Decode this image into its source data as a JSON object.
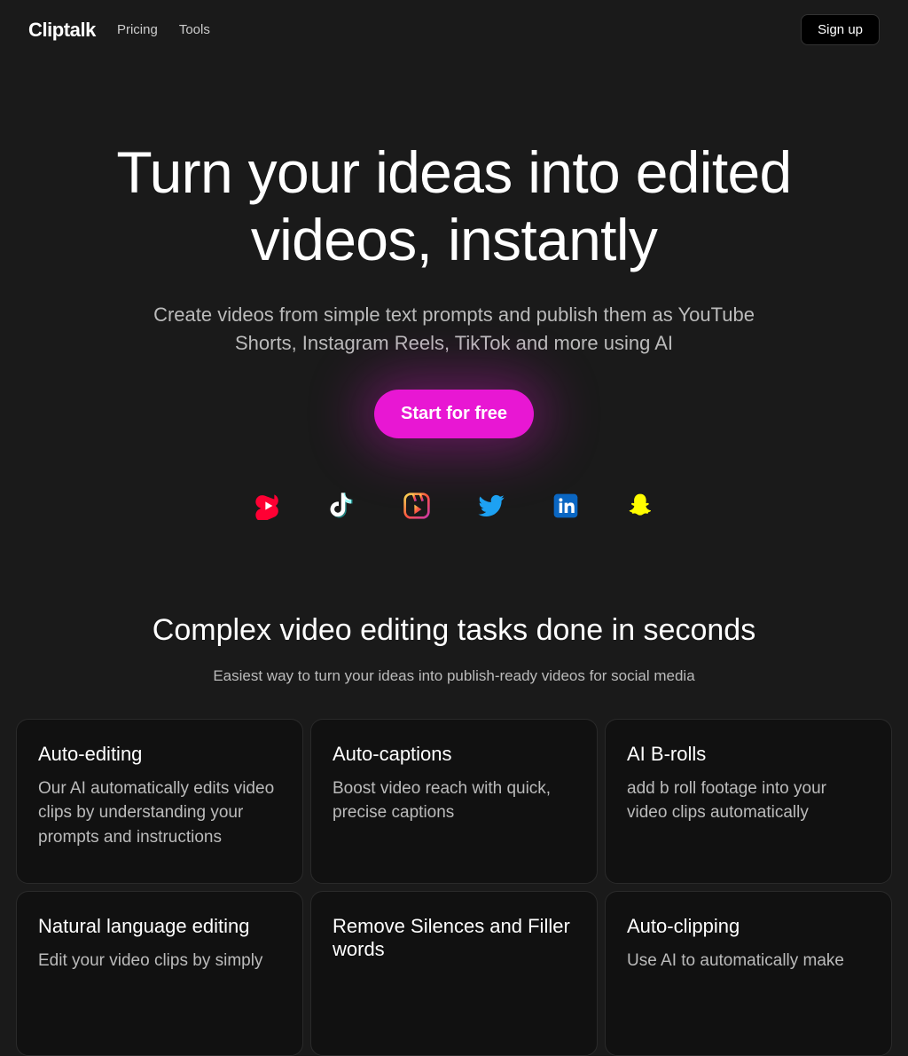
{
  "header": {
    "logo": "Cliptalk",
    "links": [
      {
        "label": "Pricing"
      },
      {
        "label": "Tools"
      }
    ],
    "signup": "Sign up"
  },
  "hero": {
    "headline": "Turn your ideas into edited videos, instantly",
    "subhead": "Create videos from simple text prompts and publish them as YouTube Shorts, Instagram Reels, TikTok and more using AI",
    "cta": "Start for free",
    "platforms": [
      "youtube-shorts",
      "tiktok",
      "instagram-reels",
      "twitter",
      "linkedin",
      "snapchat"
    ]
  },
  "features": {
    "headline": "Complex video editing tasks done in seconds",
    "subhead": "Easiest way to turn your ideas into publish-ready videos for social media",
    "cards": [
      {
        "title": "Auto-editing",
        "desc": "Our AI automatically edits video clips by understanding your prompts and instructions"
      },
      {
        "title": "Auto-captions",
        "desc": "Boost video reach with quick, precise captions"
      },
      {
        "title": "AI B-rolls",
        "desc": "add b roll footage into your video clips automatically"
      },
      {
        "title": "Natural language editing",
        "desc": "Edit your video clips by simply"
      },
      {
        "title": "Remove Silences and Filler words",
        "desc": ""
      },
      {
        "title": "Auto-clipping",
        "desc": "Use AI to automatically make"
      }
    ]
  }
}
